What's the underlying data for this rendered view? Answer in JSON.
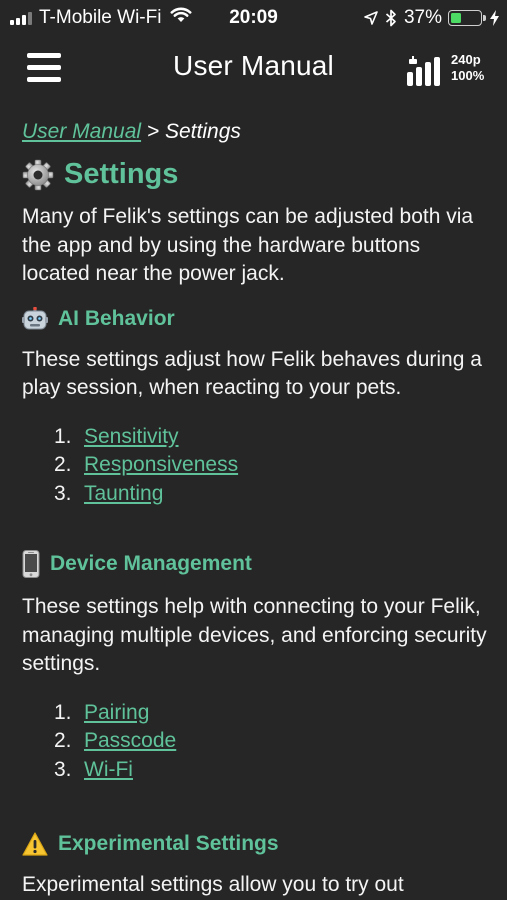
{
  "status_bar": {
    "carrier": "T-Mobile Wi-Fi",
    "time": "20:09",
    "battery_percent": "37%",
    "battery_level": 0.37,
    "icons": [
      "signal-icon",
      "wifi-icon",
      "location-icon",
      "bluetooth-icon",
      "battery-icon",
      "charging-icon"
    ]
  },
  "nav": {
    "title": "User Manual",
    "quality_resolution": "240p",
    "quality_percent": "100%",
    "menu_icon": "hamburger-menu-icon"
  },
  "breadcrumb": {
    "link": "User Manual",
    "separator": " > ",
    "current": "Settings"
  },
  "page": {
    "title": "Settings",
    "title_icon": "gear-icon",
    "intro": "Many of Felik's settings can be adjusted both via the app and by using the hardware buttons located near the power jack."
  },
  "sections": [
    {
      "title": "AI Behavior",
      "icon": "robot-icon",
      "text": "These settings adjust how Felik behaves during a play session, when reacting to your pets.",
      "links": [
        {
          "num": "1.",
          "label": "Sensitivity"
        },
        {
          "num": "2.",
          "label": "Responsiveness"
        },
        {
          "num": "3.",
          "label": "Taunting"
        }
      ]
    },
    {
      "title": "Device Management",
      "icon": "mobile-phone-icon",
      "text": "These settings help with connecting to your Felik, managing multiple devices, and enforcing security settings.",
      "links": [
        {
          "num": "1.",
          "label": "Pairing"
        },
        {
          "num": "2.",
          "label": "Passcode"
        },
        {
          "num": "3.",
          "label": "Wi-Fi"
        }
      ]
    },
    {
      "title": "Experimental Settings",
      "icon": "warning-icon",
      "text": "Experimental settings allow you to try out"
    }
  ],
  "colors": {
    "background": "#262626",
    "accent": "#5fc29a",
    "text": "#f4f4f4",
    "battery": "#4cd964"
  }
}
